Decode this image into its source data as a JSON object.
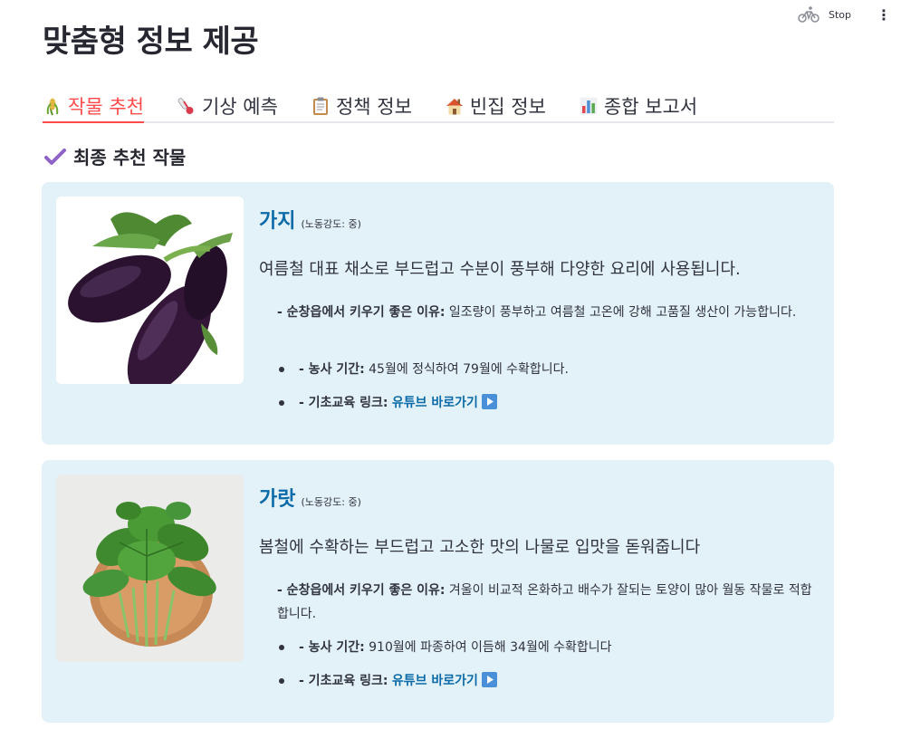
{
  "topbar": {
    "stop_label": "Stop",
    "menu_glyph": "⋮",
    "running_icon": "bicycle-icon"
  },
  "page_title": "맞춤형 정보 제공",
  "tabs": [
    {
      "label": "작물 추천",
      "icon": "crop-icon",
      "active": true
    },
    {
      "label": "기상 예측",
      "icon": "thermometer-icon",
      "active": false
    },
    {
      "label": "정책 정보",
      "icon": "clipboard-icon",
      "active": false
    },
    {
      "label": "빈집 정보",
      "icon": "house-icon",
      "active": false
    },
    {
      "label": "종합 보고서",
      "icon": "bar-chart-icon",
      "active": false
    }
  ],
  "section_heading": "최종 추천 작물",
  "crops": [
    {
      "name": "가지",
      "labor": "(노동강도: 중)",
      "description": "여름철 대표 채소로 부드럽고 수분이 풍부해 다양한 요리에 사용됩니다.",
      "reason_label": "- 순창읍에서 키우기 좋은 이유:",
      "reason_text": " 일조량이 풍부하고 여름철 고온에 강해 고품질 생산이 가능합니다.",
      "period_label": "- 농사 기간:",
      "period_text": " 45월에 정식하여 79월에 수확합니다.",
      "link_label": "- 기초교육 링크:",
      "link_text": "유튜브 바로가기",
      "image": "eggplant-image",
      "accent_color": "#3a1a3e"
    },
    {
      "name": "가랏",
      "labor": "(노동강도: 중)",
      "description": "봄철에 수확하는 부드럽고 고소한 맛의 나물로 입맛을 돋워줍니다",
      "reason_label": "- 순창읍에서 키우기 좋은 이유:",
      "reason_text": " 겨울이 비교적 온화하고 배수가 잘되는 토양이 많아 월동 작물로 적합합니다.",
      "period_label": "- 농사 기간:",
      "period_text": " 910월에 파종하여 이듬해 34월에 수확합니다",
      "link_label": "- 기초교육 링크:",
      "link_text": "유튜브 바로가기",
      "image": "arugula-image",
      "accent_color": "#3f8a2e"
    }
  ],
  "colors": {
    "accent_red": "#ff4b4b",
    "card_bg": "#e3f1f8",
    "link_blue": "#0b6ba8",
    "text": "#31333f"
  }
}
